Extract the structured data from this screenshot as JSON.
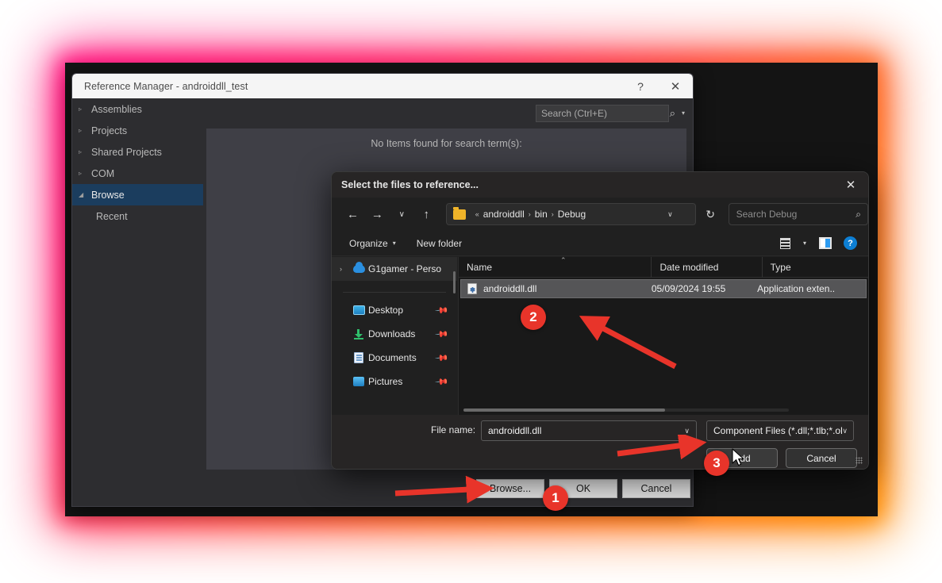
{
  "reference_manager": {
    "title": "Reference Manager - androiddll_test",
    "titlebar_buttons": [
      {
        "name": "help",
        "glyph": "?"
      },
      {
        "name": "close",
        "glyph": "✕"
      }
    ],
    "tree": [
      {
        "label": "Assemblies",
        "expander": "▹",
        "selected": false,
        "sub": false
      },
      {
        "label": "Projects",
        "expander": "▹",
        "selected": false,
        "sub": false
      },
      {
        "label": "Shared Projects",
        "expander": "▹",
        "selected": false,
        "sub": false
      },
      {
        "label": "COM",
        "expander": "▹",
        "selected": false,
        "sub": false
      },
      {
        "label": "Browse",
        "expander": "◢",
        "selected": true,
        "sub": false
      },
      {
        "label": "Recent",
        "expander": "",
        "selected": false,
        "sub": true
      }
    ],
    "search": {
      "placeholder": "Search (Ctrl+E)",
      "icon": "search-icon",
      "chevron": "▾"
    },
    "empty_message": "No Items found for search term(s):",
    "buttons": {
      "browse": "Browse...",
      "ok": "OK",
      "cancel": "Cancel"
    }
  },
  "file_picker": {
    "title": "Select the files to reference...",
    "close_glyph": "✕",
    "nav": {
      "back": "←",
      "forward": "→",
      "recent": "∨",
      "up": "↑",
      "refresh": "↻"
    },
    "breadcrumb": {
      "prefix": "«",
      "segments": [
        "androiddll",
        "bin",
        "Debug"
      ],
      "separator": "›",
      "chevron": "∨"
    },
    "search": {
      "placeholder": "Search Debug",
      "icon": "search-icon"
    },
    "toolbar": {
      "organize": "Organize",
      "organize_chevron": "▾",
      "new_folder": "New folder",
      "view_chevron": "▾",
      "help_glyph": "?"
    },
    "sidebar": [
      {
        "label": "G1gamer - Perso",
        "icon": "onedrive-cloud-icon",
        "chevron": "›",
        "pinned": false,
        "highlight": true
      },
      {
        "label": "Desktop",
        "icon": "desktop-icon",
        "chevron": "",
        "pinned": true,
        "highlight": false
      },
      {
        "label": "Downloads",
        "icon": "downloads-icon",
        "chevron": "",
        "pinned": true,
        "highlight": false
      },
      {
        "label": "Documents",
        "icon": "documents-icon",
        "chevron": "",
        "pinned": true,
        "highlight": false
      },
      {
        "label": "Pictures",
        "icon": "pictures-icon",
        "chevron": "",
        "pinned": true,
        "highlight": false
      }
    ],
    "pin_glyph": "▬",
    "columns": [
      "Name",
      "Date modified",
      "Type"
    ],
    "sort_caret": "⌃",
    "rows": [
      {
        "name": "androiddll.dll",
        "date_modified": "05/09/2024 19:55",
        "type": "Application exten..",
        "icon": "dll-file-icon",
        "selected": true
      }
    ],
    "footer": {
      "file_name_label": "File name:",
      "file_name_value": "androiddll.dll",
      "file_name_chevron": "∨",
      "filter_value": "Component Files (*.dll;*.tlb;*.ol",
      "filter_chevron": "∨",
      "add_button": "Add",
      "cancel_button": "Cancel"
    }
  },
  "annotations": {
    "markers": [
      {
        "id": "1",
        "label": "1"
      },
      {
        "id": "2",
        "label": "2"
      },
      {
        "id": "3",
        "label": "3"
      }
    ],
    "marker_color": "#e8342a"
  },
  "theme": {
    "glow_start": "#ff0d7b",
    "glow_end": "#ff8a00",
    "accent_blue": "#0d7fd4",
    "selection_blue": "#1b3d5e"
  }
}
